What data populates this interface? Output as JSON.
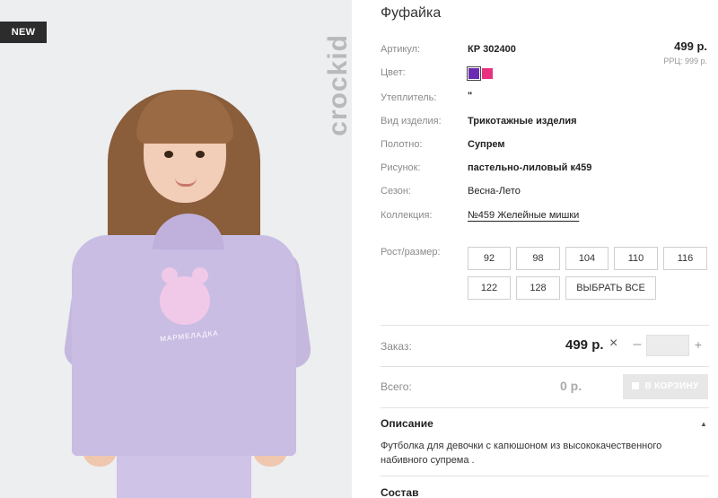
{
  "product": {
    "badge": "NEW",
    "brand": "crockid",
    "print_text": "МАРМЕЛАДКА",
    "title": "Фуфайка",
    "price": "499 р.",
    "rrc": "РРЦ: 999 р."
  },
  "attributes": [
    {
      "label": "Артикул:",
      "value": "КР 302400"
    },
    {
      "label": "Цвет:",
      "value": ""
    },
    {
      "label": "Утеплитель:",
      "value": "\""
    },
    {
      "label": "Вид изделия:",
      "value": "Трикотажные изделия"
    },
    {
      "label": "Полотно:",
      "value": "Супрем"
    },
    {
      "label": "Рисунок:",
      "value": "пастельно-лиловый к459"
    },
    {
      "label": "Сезон:",
      "value": "Весна-Лето"
    },
    {
      "label": "Коллекция:",
      "value": "№459 Желейные мишки"
    }
  ],
  "colors": [
    "#6a2bb0",
    "#e8327f"
  ],
  "sizes": {
    "label": "Рост/размер:",
    "options": [
      "92",
      "98",
      "104",
      "110",
      "116",
      "122",
      "128"
    ],
    "select_all": "ВЫБРАТЬ ВСЕ"
  },
  "order": {
    "label": "Заказ:",
    "price": "499 р.",
    "quantity": ""
  },
  "total": {
    "label": "Всего:",
    "value": "0 р.",
    "cart_button": "В КОРЗИНУ"
  },
  "description": {
    "title": "Описание",
    "text": "Футболка для девочки с капюшоном из высококачественного набивного супрема ."
  },
  "composition": {
    "title": "Состав"
  }
}
